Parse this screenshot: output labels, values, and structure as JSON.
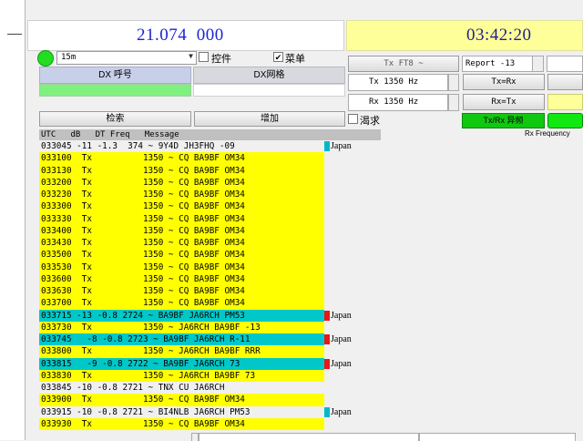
{
  "display": {
    "frequency": "21.074  000",
    "clock": "03:42:20"
  },
  "band": {
    "value": "15m"
  },
  "checkboxes": {
    "control": {
      "label": "控件",
      "checked": false
    },
    "menu": {
      "label": "菜单",
      "checked": true
    },
    "quiet": {
      "label": "渴求",
      "checked": false
    }
  },
  "dx": {
    "call_header": "DX 呼号",
    "grid_header": "DX网格",
    "call_value": "",
    "grid_value": ""
  },
  "buttons": {
    "search": "检索",
    "add": "增加",
    "tx_mode": "Tx FT8 ~",
    "tx_eq_rx": "Tx=Rx",
    "rx_eq_tx": "Rx=Tx",
    "split": "Tx/Rx 异频"
  },
  "report": {
    "value": "Report -13"
  },
  "tx_freq": {
    "value": "Tx  1350  Hz"
  },
  "rx_freq": {
    "value": "Rx  1350  Hz"
  },
  "rx_frequency_label": "Rx Frequency",
  "table": {
    "header": "UTC   dB   DT Freq   Message",
    "rows": [
      {
        "text": "033045 -11 -1.3  374 ~ 9Y4D JH3FHQ -09",
        "bg": "white",
        "mark": "#00b8c8",
        "country": "Japan"
      },
      {
        "text": "033100  Tx          1350 ~ CQ BA9BF OM34",
        "bg": "yellow",
        "mark": "",
        "country": ""
      },
      {
        "text": "033130  Tx          1350 ~ CQ BA9BF OM34",
        "bg": "yellow",
        "mark": "",
        "country": ""
      },
      {
        "text": "033200  Tx          1350 ~ CQ BA9BF OM34",
        "bg": "yellow",
        "mark": "",
        "country": ""
      },
      {
        "text": "033230  Tx          1350 ~ CQ BA9BF OM34",
        "bg": "yellow",
        "mark": "",
        "country": ""
      },
      {
        "text": "033300  Tx          1350 ~ CQ BA9BF OM34",
        "bg": "yellow",
        "mark": "",
        "country": ""
      },
      {
        "text": "033330  Tx          1350 ~ CQ BA9BF OM34",
        "bg": "yellow",
        "mark": "",
        "country": ""
      },
      {
        "text": "033400  Tx          1350 ~ CQ BA9BF OM34",
        "bg": "yellow",
        "mark": "",
        "country": ""
      },
      {
        "text": "033430  Tx          1350 ~ CQ BA9BF OM34",
        "bg": "yellow",
        "mark": "",
        "country": ""
      },
      {
        "text": "033500  Tx          1350 ~ CQ BA9BF OM34",
        "bg": "yellow",
        "mark": "",
        "country": ""
      },
      {
        "text": "033530  Tx          1350 ~ CQ BA9BF OM34",
        "bg": "yellow",
        "mark": "",
        "country": ""
      },
      {
        "text": "033600  Tx          1350 ~ CQ BA9BF OM34",
        "bg": "yellow",
        "mark": "",
        "country": ""
      },
      {
        "text": "033630  Tx          1350 ~ CQ BA9BF OM34",
        "bg": "yellow",
        "mark": "",
        "country": ""
      },
      {
        "text": "033700  Tx          1350 ~ CQ BA9BF OM34",
        "bg": "yellow",
        "mark": "",
        "country": ""
      },
      {
        "text": "033715 -13 -0.8 2724 ~ BA9BF JA6RCH PM53",
        "bg": "cyan",
        "mark": "#e81818",
        "country": "Japan"
      },
      {
        "text": "033730  Tx          1350 ~ JA6RCH BA9BF -13",
        "bg": "yellow",
        "mark": "",
        "country": ""
      },
      {
        "text": "033745   -8 -0.8 2723 ~ BA9BF JA6RCH R-11",
        "bg": "cyan",
        "mark": "#e81818",
        "country": "Japan"
      },
      {
        "text": "033800  Tx          1350 ~ JA6RCH BA9BF RRR",
        "bg": "yellow",
        "mark": "",
        "country": ""
      },
      {
        "text": "033815   -9 -0.8 2722 ~ BA9BF JA6RCH 73",
        "bg": "cyan",
        "mark": "#e81818",
        "country": "Japan"
      },
      {
        "text": "033830  Tx          1350 ~ JA6RCH BA9BF 73",
        "bg": "yellow",
        "mark": "",
        "country": ""
      },
      {
        "text": "033845 -10 -0.8 2721 ~ TNX CU JA6RCH",
        "bg": "white",
        "mark": "",
        "country": ""
      },
      {
        "text": "033900  Tx          1350 ~ CQ BA9BF OM34",
        "bg": "yellow",
        "mark": "",
        "country": ""
      },
      {
        "text": "033915 -10 -0.8 2721 ~ BI4NLB JA6RCH PM53",
        "bg": "white",
        "mark": "#00b8c8",
        "country": "Japan"
      },
      {
        "text": "033930  Tx          1350 ~ CQ BA9BF OM34",
        "bg": "yellow",
        "mark": "",
        "country": ""
      }
    ]
  }
}
